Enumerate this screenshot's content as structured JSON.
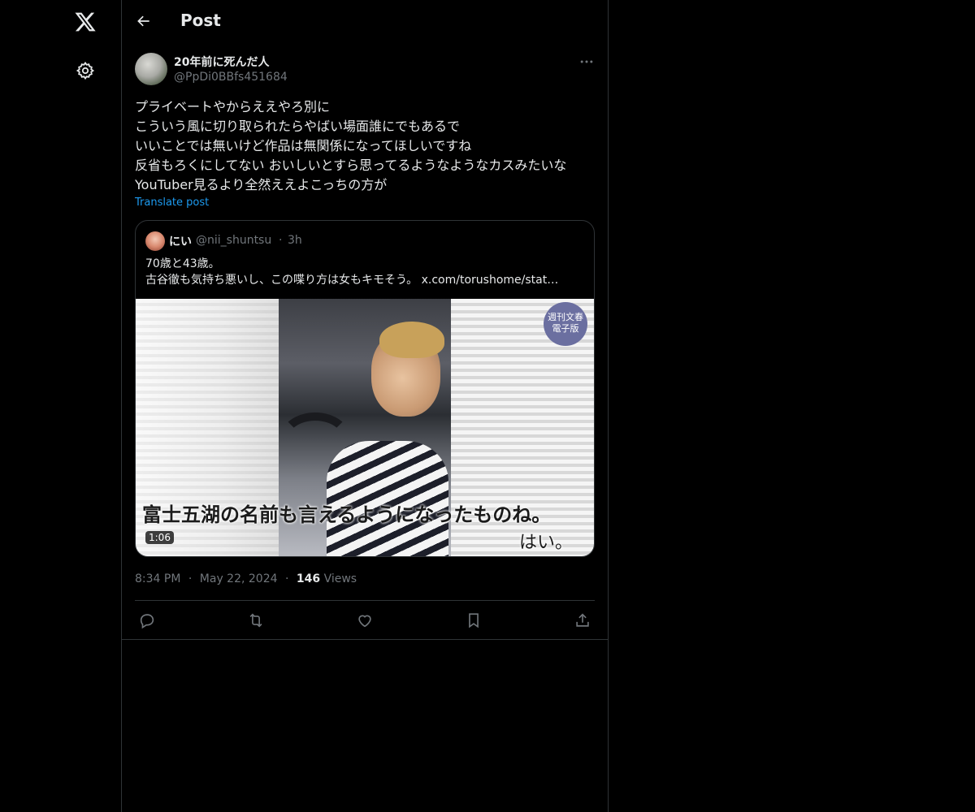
{
  "nav": {
    "logo_icon": "x-logo-icon",
    "settings_icon": "gear-icon"
  },
  "header": {
    "back_icon": "arrow-left-icon",
    "title": "Post"
  },
  "post": {
    "author": {
      "display_name": "20年前に死んだ人",
      "handle": "@PpDi0BBfs451684"
    },
    "more_icon": "ellipsis-icon",
    "lines": [
      "プライベートやからええやろ別に",
      "こういう風に切り取られたらやばい場面誰にでもあるで",
      "いいことでは無いけど作品は無関係になってほしいですね",
      "反省もろくにしてない おいしいとすら思ってるようなようなカスみたいな",
      "YouTuber見るより全然ええよこっちの方が"
    ],
    "translate_label": "Translate post",
    "quote": {
      "display_name": "にい",
      "handle": "@nii_shuntsu",
      "separator": "·",
      "time": "3h",
      "text_line1": "70歳と43歳。",
      "text_line2": "古谷徹も気持ち悪いし、この喋り方は女もキモそう。",
      "link": "x.com/torushome/stat…",
      "video": {
        "badge_line1": "週刊文春",
        "badge_line2": "電子版",
        "subtitle": "富士五湖の名前も言えるようになったものね。",
        "subtitle_reply": "はい。",
        "duration": "1:06"
      }
    },
    "meta": {
      "time": "8:34 PM",
      "date": "May 22, 2024",
      "views_count": "146",
      "views_label": "Views",
      "separator": "·"
    },
    "actions": {
      "reply_icon": "reply-icon",
      "repost_icon": "repost-icon",
      "like_icon": "heart-icon",
      "bookmark_icon": "bookmark-icon",
      "share_icon": "share-icon"
    }
  },
  "colors": {
    "background": "#000000",
    "text": "#e7e9ea",
    "muted": "#71767b",
    "accent": "#1d9bf0",
    "border": "#2f3336"
  }
}
